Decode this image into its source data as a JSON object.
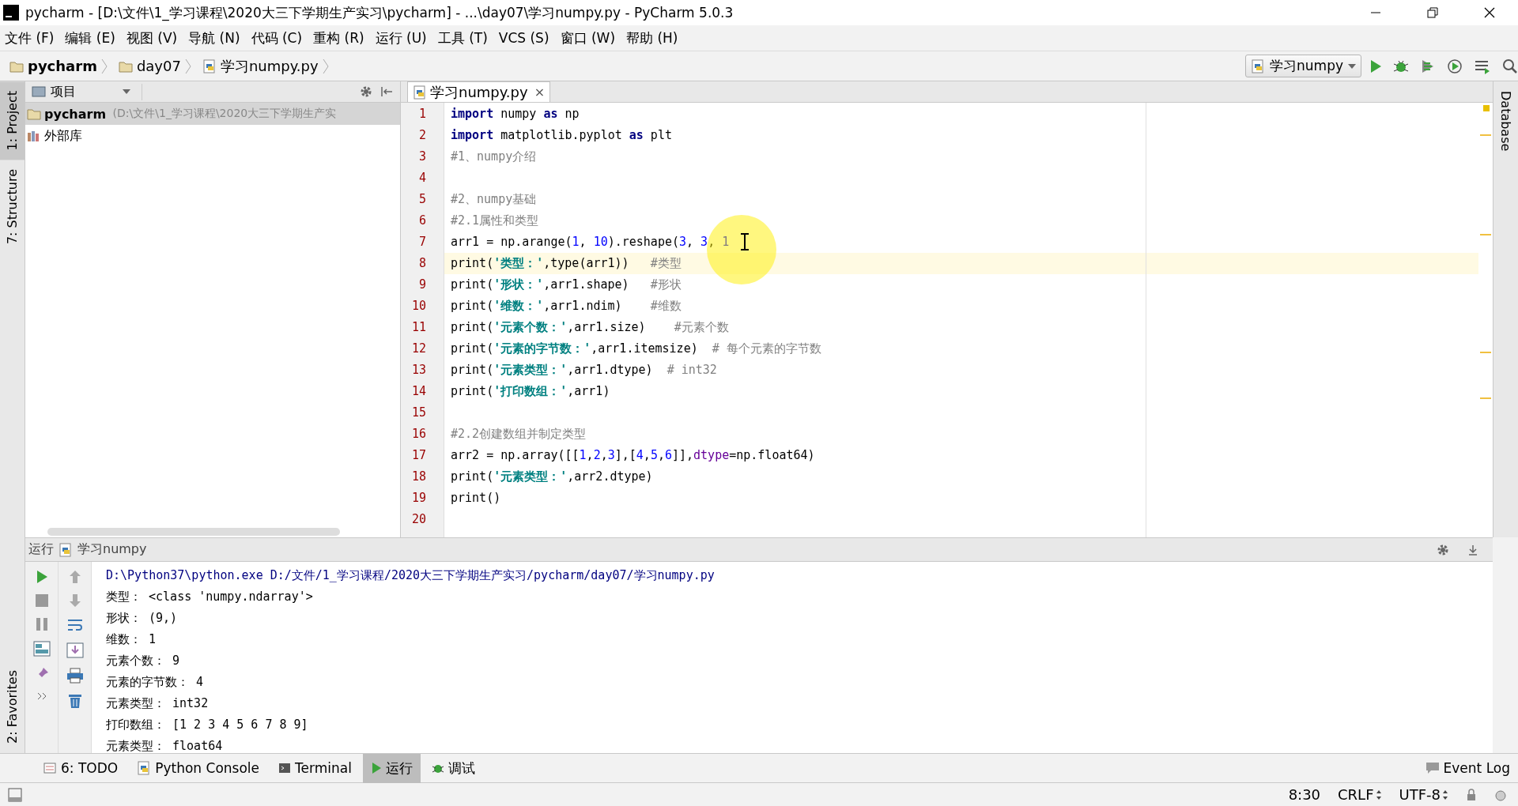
{
  "window": {
    "title": "pycharm - [D:\\文件\\1_学习课程\\2020大三下学期生产实习\\pycharm] - ...\\day07\\学习numpy.py - PyCharm 5.0.3"
  },
  "menu": [
    "文件 (F)",
    "编辑 (E)",
    "视图 (V)",
    "导航 (N)",
    "代码 (C)",
    "重构 (R)",
    "运行 (U)",
    "工具 (T)",
    "VCS (S)",
    "窗口 (W)",
    "帮助 (H)"
  ],
  "breadcrumbs": [
    {
      "kind": "project",
      "label": "pycharm"
    },
    {
      "kind": "folder",
      "label": "day07"
    },
    {
      "kind": "file",
      "label": "学习numpy.py"
    }
  ],
  "run_config": "学习numpy",
  "left_stripe": [
    {
      "label": "1: Project",
      "selected": true
    },
    {
      "label": "7: Structure",
      "selected": false
    }
  ],
  "left_stripe_bottom": [
    {
      "label": "2: Favorites",
      "selected": false
    }
  ],
  "right_stripe": [
    {
      "label": "Database",
      "selected": false
    }
  ],
  "project_panel": {
    "title": "项目",
    "items": [
      {
        "kind": "project",
        "label": "pycharm",
        "detail": "(D:\\文件\\1_学习课程\\2020大三下学期生产实",
        "selected": true
      },
      {
        "kind": "library",
        "label": "外部库",
        "selected": false
      }
    ]
  },
  "editor_tab": {
    "label": "学习numpy.py",
    "close": "×"
  },
  "code": [
    {
      "number": "1",
      "current": false,
      "tokens": [
        {
          "kind": "kw",
          "text": "import"
        },
        {
          "kind": "plain",
          "text": " numpy "
        },
        {
          "kind": "kw",
          "text": "as"
        },
        {
          "kind": "plain",
          "text": " np"
        }
      ]
    },
    {
      "number": "2",
      "current": false,
      "tokens": [
        {
          "kind": "kw",
          "text": "import"
        },
        {
          "kind": "plain",
          "text": " matplotlib.pyplot "
        },
        {
          "kind": "kw",
          "text": "as"
        },
        {
          "kind": "plain",
          "text": " plt"
        }
      ]
    },
    {
      "number": "3",
      "current": false,
      "tokens": [
        {
          "kind": "cmt",
          "text": "#1、numpy介绍"
        }
      ]
    },
    {
      "number": "4",
      "current": false
    },
    {
      "number": "5",
      "current": false,
      "tokens": [
        {
          "kind": "cmt",
          "text": "#2、numpy基础"
        }
      ]
    },
    {
      "number": "6",
      "current": false,
      "tokens": [
        {
          "kind": "cmt",
          "text": "#2.1属性和类型"
        }
      ]
    },
    {
      "number": "7",
      "current": false,
      "tokens": [
        {
          "kind": "plain",
          "text": "arr1 = np.arange("
        },
        {
          "kind": "num",
          "text": "1"
        },
        {
          "kind": "plain",
          "text": ", "
        },
        {
          "kind": "num",
          "text": "10"
        },
        {
          "kind": "plain",
          "text": ").reshape("
        },
        {
          "kind": "num",
          "text": "3"
        },
        {
          "kind": "plain",
          "text": ", "
        },
        {
          "kind": "num",
          "text": "3"
        },
        {
          "kind": "plain",
          "text": ", "
        },
        {
          "kind": "num",
          "text": "1"
        }
      ]
    },
    {
      "number": "8",
      "current": true,
      "tokens": [
        {
          "kind": "plain",
          "text": "print("
        },
        {
          "kind": "str",
          "text": "'类型：'"
        },
        {
          "kind": "plain",
          "text": ",type(arr1))   "
        },
        {
          "kind": "cmt",
          "text": "#类型"
        }
      ]
    },
    {
      "number": "9",
      "current": false,
      "tokens": [
        {
          "kind": "plain",
          "text": "print("
        },
        {
          "kind": "str",
          "text": "'形状：'"
        },
        {
          "kind": "plain",
          "text": ",arr1.shape)   "
        },
        {
          "kind": "cmt",
          "text": "#形状"
        }
      ]
    },
    {
      "number": "10",
      "current": false,
      "tokens": [
        {
          "kind": "plain",
          "text": "print("
        },
        {
          "kind": "str",
          "text": "'维数：'"
        },
        {
          "kind": "plain",
          "text": ",arr1.ndim)    "
        },
        {
          "kind": "cmt",
          "text": "#维数"
        }
      ]
    },
    {
      "number": "11",
      "current": false,
      "tokens": [
        {
          "kind": "plain",
          "text": "print("
        },
        {
          "kind": "str",
          "text": "'元素个数：'"
        },
        {
          "kind": "plain",
          "text": ",arr1.size)    "
        },
        {
          "kind": "cmt",
          "text": "#元素个数"
        }
      ]
    },
    {
      "number": "12",
      "current": false,
      "tokens": [
        {
          "kind": "plain",
          "text": "print("
        },
        {
          "kind": "str",
          "text": "'元素的字节数：'"
        },
        {
          "kind": "plain",
          "text": ",arr1.itemsize)  "
        },
        {
          "kind": "cmt",
          "text": "# 每个元素的字节数"
        }
      ]
    },
    {
      "number": "13",
      "current": false,
      "tokens": [
        {
          "kind": "plain",
          "text": "print("
        },
        {
          "kind": "str",
          "text": "'元素类型：'"
        },
        {
          "kind": "plain",
          "text": ",arr1.dtype)  "
        },
        {
          "kind": "cmt",
          "text": "# int32"
        }
      ]
    },
    {
      "number": "14",
      "current": false,
      "tokens": [
        {
          "kind": "plain",
          "text": "print("
        },
        {
          "kind": "str",
          "text": "'打印数组：'"
        },
        {
          "kind": "plain",
          "text": ",arr1)"
        }
      ]
    },
    {
      "number": "15",
      "current": false
    },
    {
      "number": "16",
      "current": false,
      "tokens": [
        {
          "kind": "cmt",
          "text": "#2.2创建数组并制定类型"
        }
      ]
    },
    {
      "number": "17",
      "current": false,
      "tokens": [
        {
          "kind": "plain",
          "text": "arr2 = np.array([["
        },
        {
          "kind": "num",
          "text": "1"
        },
        {
          "kind": "plain",
          "text": ","
        },
        {
          "kind": "num",
          "text": "2"
        },
        {
          "kind": "plain",
          "text": ","
        },
        {
          "kind": "num",
          "text": "3"
        },
        {
          "kind": "plain",
          "text": "],["
        },
        {
          "kind": "num",
          "text": "4"
        },
        {
          "kind": "plain",
          "text": ","
        },
        {
          "kind": "num",
          "text": "5"
        },
        {
          "kind": "plain",
          "text": ","
        },
        {
          "kind": "num",
          "text": "6"
        },
        {
          "kind": "plain",
          "text": "]],"
        },
        {
          "kind": "param",
          "text": "dtype"
        },
        {
          "kind": "plain",
          "text": "=np.float64)"
        }
      ]
    },
    {
      "number": "18",
      "current": false,
      "tokens": [
        {
          "kind": "plain",
          "text": "print("
        },
        {
          "kind": "str",
          "text": "'元素类型：'"
        },
        {
          "kind": "plain",
          "text": ",arr2.dtype)"
        }
      ]
    },
    {
      "number": "19",
      "current": false,
      "tokens": [
        {
          "kind": "plain",
          "text": "print()"
        }
      ]
    },
    {
      "number": "20",
      "current": false
    }
  ],
  "run_panel": {
    "label": "运行",
    "config": "学习numpy",
    "console": [
      {
        "kind": "command",
        "text": "D:\\Python37\\python.exe D:/文件/1_学习课程/2020大三下学期生产实习/pycharm/day07/学习numpy.py"
      },
      {
        "kind": "output",
        "text": "类型： <class 'numpy.ndarray'>"
      },
      {
        "kind": "output",
        "text": "形状： (9,)"
      },
      {
        "kind": "output",
        "text": "维数： 1"
      },
      {
        "kind": "output",
        "text": "元素个数： 9"
      },
      {
        "kind": "output",
        "text": "元素的字节数： 4"
      },
      {
        "kind": "output",
        "text": "元素类型： int32"
      },
      {
        "kind": "output",
        "text": "打印数组： [1 2 3 4 5 6 7 8 9]"
      },
      {
        "kind": "output",
        "text": "元素类型： float64"
      }
    ]
  },
  "tool_tabs": [
    {
      "kind": "todo",
      "label": "6: TODO",
      "selected": false
    },
    {
      "kind": "python",
      "label": "Python Console",
      "selected": false
    },
    {
      "kind": "terminal",
      "label": "Terminal",
      "selected": false
    },
    {
      "kind": "run",
      "label": "运行",
      "selected": true
    },
    {
      "kind": "debug",
      "label": "调试",
      "selected": false
    }
  ],
  "event_log": "Event Log",
  "status_bar": {
    "position": "8:30",
    "line_separator": "CRLF",
    "encoding": "UTF-8"
  }
}
